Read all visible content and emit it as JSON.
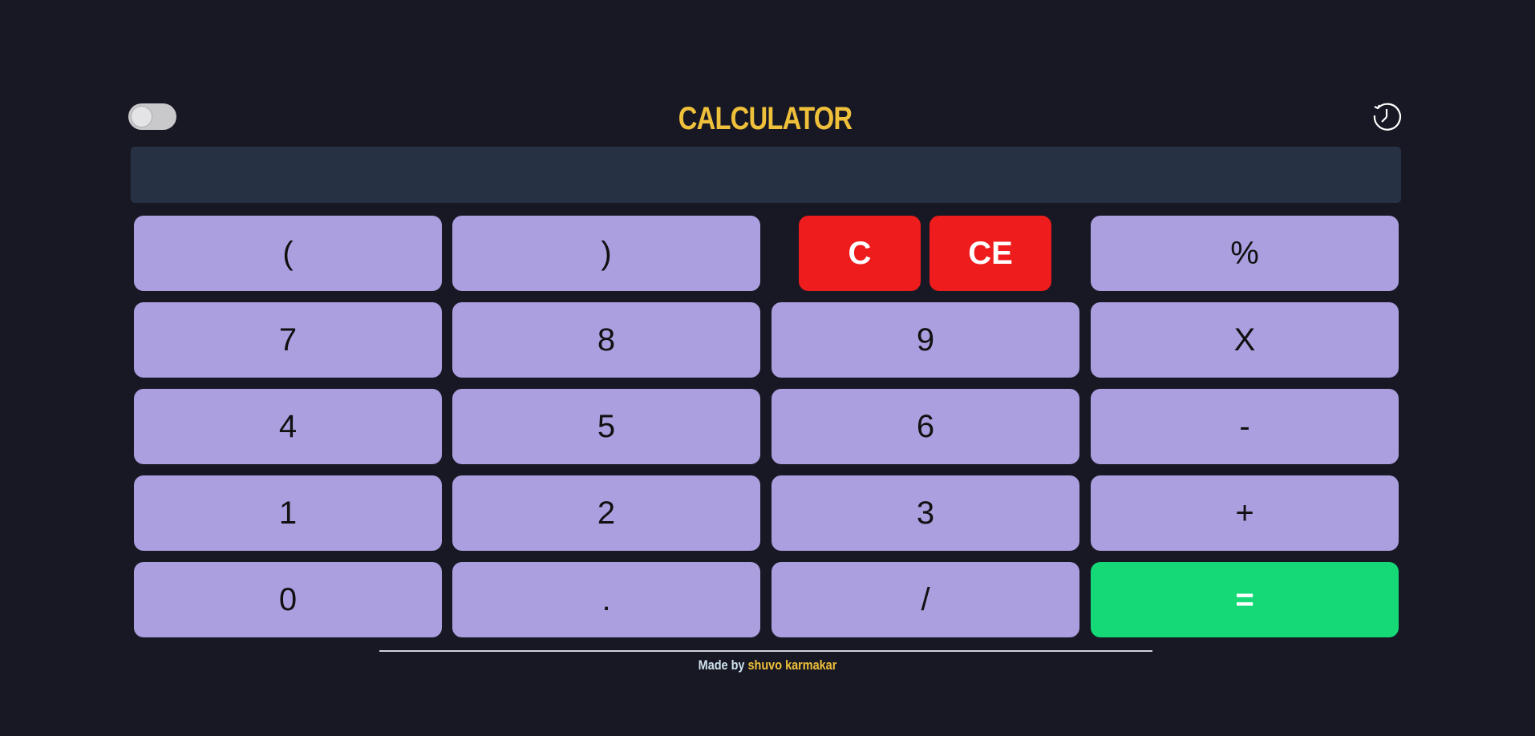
{
  "app": {
    "title": "CALCULATOR",
    "title_color": "#efc03a"
  },
  "header": {
    "theme_toggle": {
      "icon": "toggle-switch-icon",
      "state": "off"
    },
    "history_button": {
      "icon": "history-clock-icon"
    }
  },
  "display": {
    "value": ""
  },
  "buttons": {
    "open_paren": "(",
    "close_paren": ")",
    "clear": "C",
    "clear_entry": "CE",
    "percent": "%",
    "seven": "7",
    "eight": "8",
    "nine": "9",
    "multiply": "X",
    "four": "4",
    "five": "5",
    "six": "6",
    "minus": "-",
    "one": "1",
    "two": "2",
    "three": "3",
    "plus": "+",
    "zero": "0",
    "dot": ".",
    "divide": "/",
    "equals": "="
  },
  "footer": {
    "prefix": "Made by ",
    "author": "shuvo karmakar",
    "prefix_color": "#cfe3ee",
    "author_color": "#efc03a"
  },
  "colors": {
    "background": "#181824",
    "display_bg": "#263243",
    "key_bg": "#ab9fe0",
    "clear_bg": "#ee1c1c",
    "equals_bg": "#15d976"
  }
}
